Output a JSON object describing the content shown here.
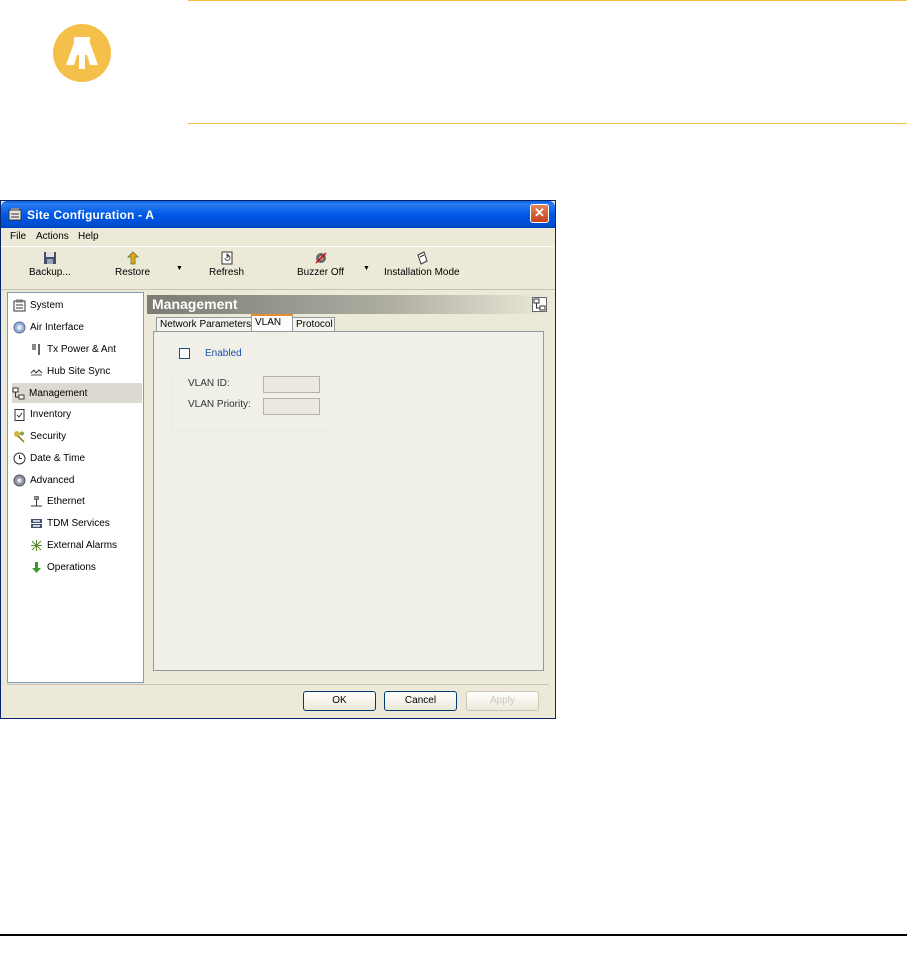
{
  "caution": {
    "icon": "warning-hand-icon"
  },
  "window": {
    "title": "Site Configuration - A",
    "close_glyph": "✕",
    "menu": [
      "File",
      "Actions",
      "Help"
    ],
    "toolbar": {
      "backup": "Backup...",
      "restore": "Restore",
      "refresh": "Refresh",
      "buzzer_off": "Buzzer Off",
      "installation_mode": "Installation Mode",
      "dropdown_glyph": "▼"
    },
    "nav": [
      {
        "label": "System",
        "icon": "system-icon"
      },
      {
        "label": "Air Interface",
        "icon": "air-interface-icon"
      },
      {
        "label": "Tx Power & Ant",
        "icon": "antenna-icon"
      },
      {
        "label": "Hub Site Sync",
        "icon": "sync-icon"
      },
      {
        "label": "Management",
        "icon": "management-icon",
        "selected": true
      },
      {
        "label": "Inventory",
        "icon": "inventory-icon"
      },
      {
        "label": "Security",
        "icon": "security-keys-icon"
      },
      {
        "label": "Date & Time",
        "icon": "clock-icon"
      },
      {
        "label": "Advanced",
        "icon": "gear-icon"
      },
      {
        "label": "Ethernet",
        "icon": "ethernet-icon"
      },
      {
        "label": "TDM Services",
        "icon": "tdm-icon"
      },
      {
        "label": "External Alarms",
        "icon": "alarm-icon"
      },
      {
        "label": "Operations",
        "icon": "operations-arrow-icon"
      }
    ],
    "panel": {
      "title": "Management",
      "tabs": [
        "Network Parameters",
        "VLAN",
        "Protocol"
      ],
      "active_tab": "VLAN",
      "vlan": {
        "enabled_label": "Enabled",
        "enabled": false,
        "vlan_id_label": "VLAN ID:",
        "vlan_id_value": "",
        "vlan_priority_label": "VLAN Priority:",
        "vlan_priority_value": ""
      }
    },
    "buttons": {
      "ok": "OK",
      "cancel": "Cancel",
      "apply": "Apply"
    }
  }
}
